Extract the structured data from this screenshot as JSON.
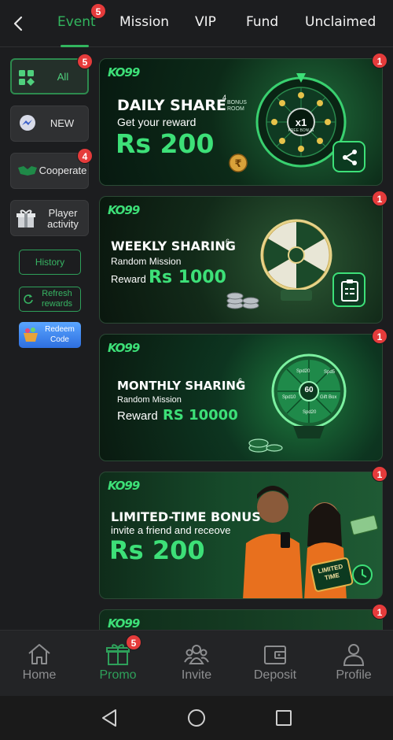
{
  "tabs": [
    {
      "label": "Event",
      "badge": "5",
      "active": true
    },
    {
      "label": "Mission"
    },
    {
      "label": "VIP"
    },
    {
      "label": "Fund"
    },
    {
      "label": "Unclaimed"
    }
  ],
  "sidebar": {
    "items": [
      {
        "label": "All",
        "badge": "5",
        "active": true
      },
      {
        "label": "NEW"
      },
      {
        "label": "Cooperate",
        "badge": "4"
      },
      {
        "label": "Player activity"
      }
    ],
    "history_label": "History",
    "refresh_label": "Refresh rewards",
    "redeem_label": "Redeem Code"
  },
  "banners": [
    {
      "logo": "KO99",
      "title": "DAILY SHARE",
      "title_sup": "4",
      "subtitle": "Get your reward",
      "amount": "Rs 200",
      "badge": "1",
      "wheel_label": "x1",
      "wheel_sub": "FREE BONUS",
      "tag": "BONUS ROOM"
    },
    {
      "logo": "KO99",
      "title": "WEEKLY SHARING",
      "title_sup": "6",
      "subtitle": "Random Mission",
      "reward_prefix": "Reward",
      "amount": "Rs 1000",
      "badge": "1"
    },
    {
      "logo": "KO99",
      "title": "MONTHLY SHARING",
      "title_sup": "6",
      "subtitle": "Random Mission",
      "reward_prefix": "Reward",
      "amount": "RS 10000",
      "badge": "1",
      "wheel_center": "60",
      "wheel_labels": [
        "Spd20",
        "Gift Box",
        "Spd5",
        "Spd10",
        "Spd20"
      ]
    },
    {
      "logo": "KO99",
      "title": "LIMITED-TIME BONUS",
      "subtitle": "invite a friend and receove",
      "amount": "Rs 200",
      "badge": "1",
      "sign": "LIMITED TIME"
    },
    {
      "logo": "KO99",
      "badge": "1"
    }
  ],
  "bottom_nav": [
    {
      "label": "Home",
      "icon": "home-icon"
    },
    {
      "label": "Promo",
      "icon": "gift-icon",
      "badge": "5",
      "active": true
    },
    {
      "label": "Invite",
      "icon": "users-icon"
    },
    {
      "label": "Deposit",
      "icon": "wallet-icon"
    },
    {
      "label": "Profile",
      "icon": "person-icon"
    }
  ],
  "colors": {
    "accent": "#2ea05a",
    "amount": "#3de078",
    "badge": "#e53b3b",
    "bg": "#1c1d1f"
  }
}
